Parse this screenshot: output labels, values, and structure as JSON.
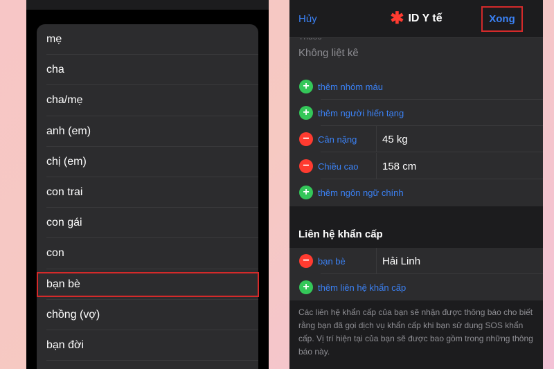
{
  "left_panel": {
    "relationships": [
      "mẹ",
      "cha",
      "cha/mẹ",
      "anh (em)",
      "chị (em)",
      "con trai",
      "con gái",
      "con",
      "bạn bè",
      "chồng (vợ)",
      "bạn đời"
    ],
    "selected": "bạn bè"
  },
  "right_panel": {
    "nav": {
      "cancel_label": "Hủy",
      "title_icon": "asterisk-icon",
      "title": "ID Y tế",
      "done_label": "Xong"
    },
    "medications": {
      "label_cut": "Thuốc",
      "value": "Không liệt kê"
    },
    "rows": [
      {
        "action": "add",
        "label": "thêm nhóm máu",
        "value": ""
      },
      {
        "action": "add",
        "label": "thêm người hiến tạng",
        "value": ""
      },
      {
        "action": "remove",
        "label": "Cân nặng",
        "value": "45 kg"
      },
      {
        "action": "remove",
        "label": "Chiều cao",
        "value": "158 cm"
      },
      {
        "action": "add",
        "label": "thêm ngôn ngữ chính",
        "value": ""
      }
    ],
    "emergency": {
      "header": "Liên hệ khẩn cấp",
      "contact_relation": "bạn bè",
      "contact_name": "Hải Linh",
      "add_label": "thêm liên hệ khẩn cấp",
      "footer": "Các liên hệ khẩn cấp của bạn sẽ nhận được thông báo cho biết rằng bạn đã gọi dịch vụ khẩn cấp khi bạn sử dụng SOS khẩn cấp. Vị trí hiện tại của bạn sẽ được bao gồm trong những thông báo này."
    },
    "colors": {
      "accent_blue": "#3b82f6",
      "add_green": "#34c759",
      "remove_red": "#ff3b30",
      "highlight_red": "#d42a2a"
    }
  }
}
